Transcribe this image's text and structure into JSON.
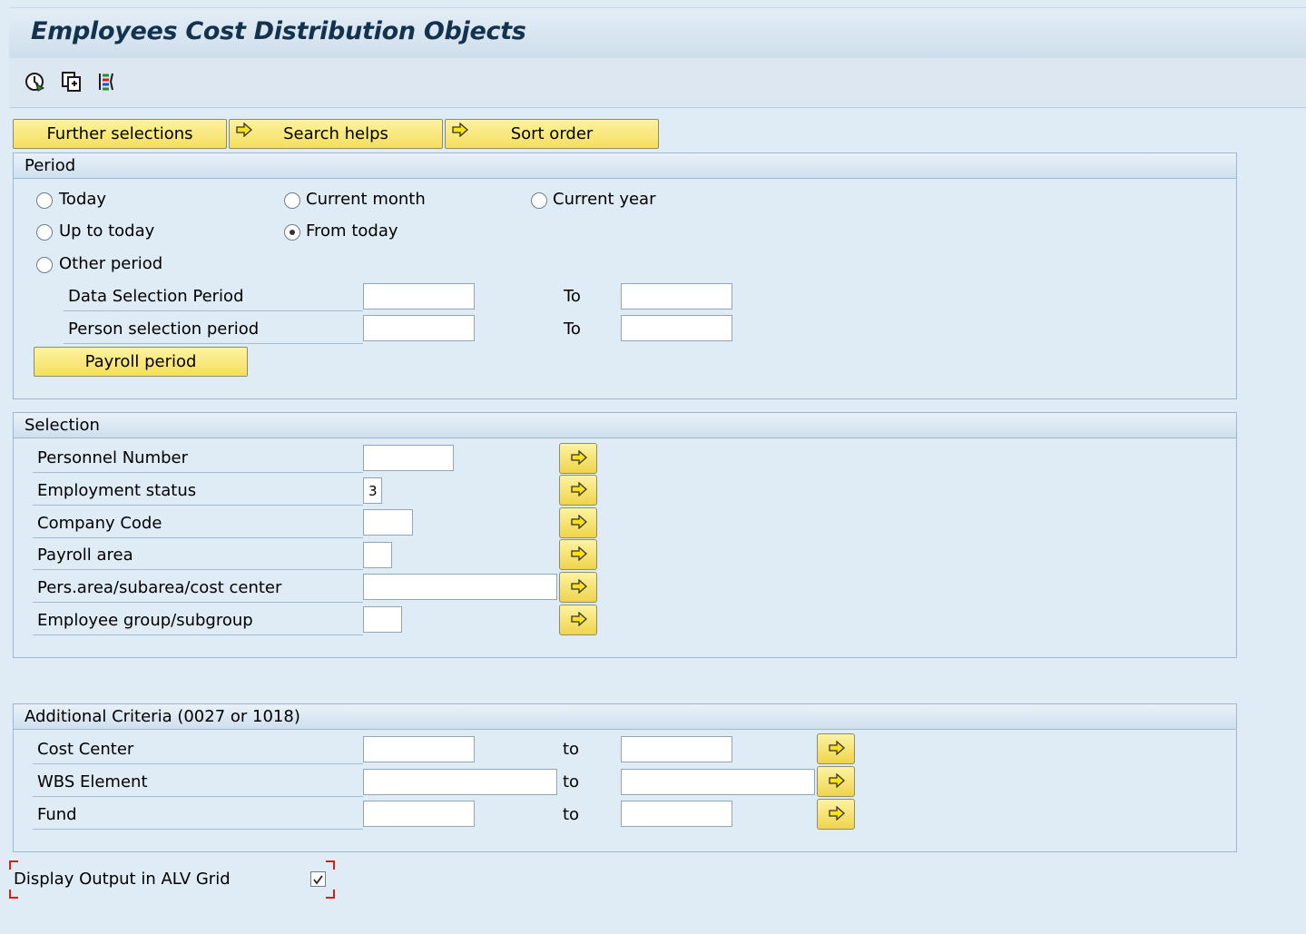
{
  "window": {
    "title": "Employees Cost Distribution Objects"
  },
  "toolbar": {
    "icons": [
      "execute-icon",
      "get-variant-icon",
      "selection-options-icon"
    ]
  },
  "top_buttons": {
    "further_selections": "Further selections",
    "search_helps": "Search helps",
    "sort_order": "Sort order"
  },
  "period": {
    "title": "Period",
    "radios": {
      "today": "Today",
      "current_month": "Current month",
      "current_year": "Current year",
      "up_to_today": "Up to today",
      "from_today": "From today",
      "other_period": "Other period"
    },
    "selected_radio": "from_today",
    "data_selection_label": "Data Selection Period",
    "person_selection_label": "Person selection period",
    "to_label": "To",
    "payroll_period_button": "Payroll period",
    "data_selection_from": "",
    "data_selection_to": "",
    "person_selection_from": "",
    "person_selection_to": ""
  },
  "selection": {
    "title": "Selection",
    "fields": {
      "personnel_number": {
        "label": "Personnel Number",
        "value": ""
      },
      "employment_status": {
        "label": "Employment status",
        "value": "3"
      },
      "company_code": {
        "label": "Company Code",
        "value": ""
      },
      "payroll_area": {
        "label": "Payroll area",
        "value": ""
      },
      "pers_area": {
        "label": "Pers.area/subarea/cost center",
        "value": ""
      },
      "employee_group": {
        "label": "Employee group/subgroup",
        "value": ""
      }
    }
  },
  "additional": {
    "title": "Additional Criteria (0027 or 1018)",
    "to_label": "to",
    "fields": {
      "cost_center": {
        "label": "Cost Center",
        "from": "",
        "to": ""
      },
      "wbs_element": {
        "label": "WBS Element",
        "from": "",
        "to": ""
      },
      "fund": {
        "label": "Fund",
        "from": "",
        "to": ""
      }
    }
  },
  "alv": {
    "label": "Display Output in ALV Grid",
    "checked": true
  },
  "colors": {
    "background": "#dfebf5",
    "button_yellow": "#f5de5e",
    "title_text": "#12324e",
    "focus_red": "#d02020"
  }
}
